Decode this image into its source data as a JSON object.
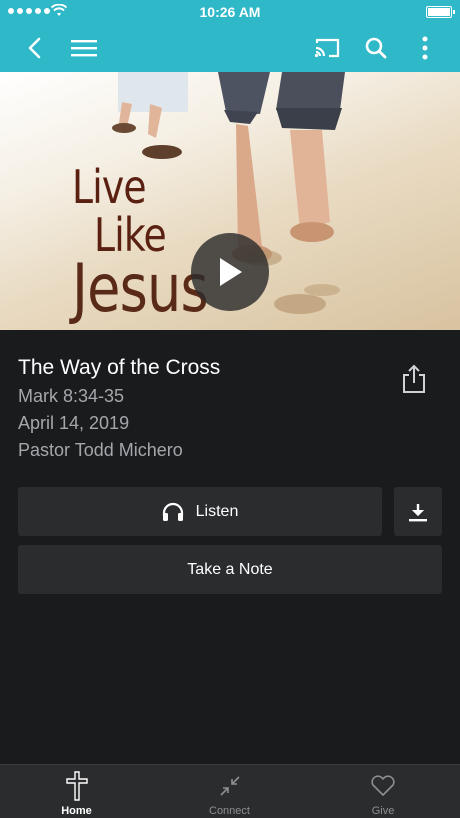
{
  "status_bar": {
    "time": "10:26 AM"
  },
  "nav": {
    "back_icon": "chevron-left-icon",
    "menu_icon": "hamburger-icon",
    "cast_icon": "cast-icon",
    "search_icon": "search-icon",
    "more_icon": "more-vertical-icon"
  },
  "hero": {
    "art_line1": "Live",
    "art_line2": "Like",
    "art_line3": "Jesus"
  },
  "sermon": {
    "title": "The Way of the Cross",
    "scripture": "Mark 8:34-35",
    "date": "April 14, 2019",
    "speaker": "Pastor Todd Michero"
  },
  "actions": {
    "listen_label": "Listen",
    "note_label": "Take a Note"
  },
  "tabs": [
    {
      "label": "Home",
      "icon": "cross-icon",
      "active": true
    },
    {
      "label": "Connect",
      "icon": "arrows-in-icon",
      "active": false
    },
    {
      "label": "Give",
      "icon": "heart-icon",
      "active": false
    }
  ],
  "colors": {
    "accent": "#2fb8c8",
    "background": "#1a1b1d",
    "button": "#2b2c2e"
  }
}
